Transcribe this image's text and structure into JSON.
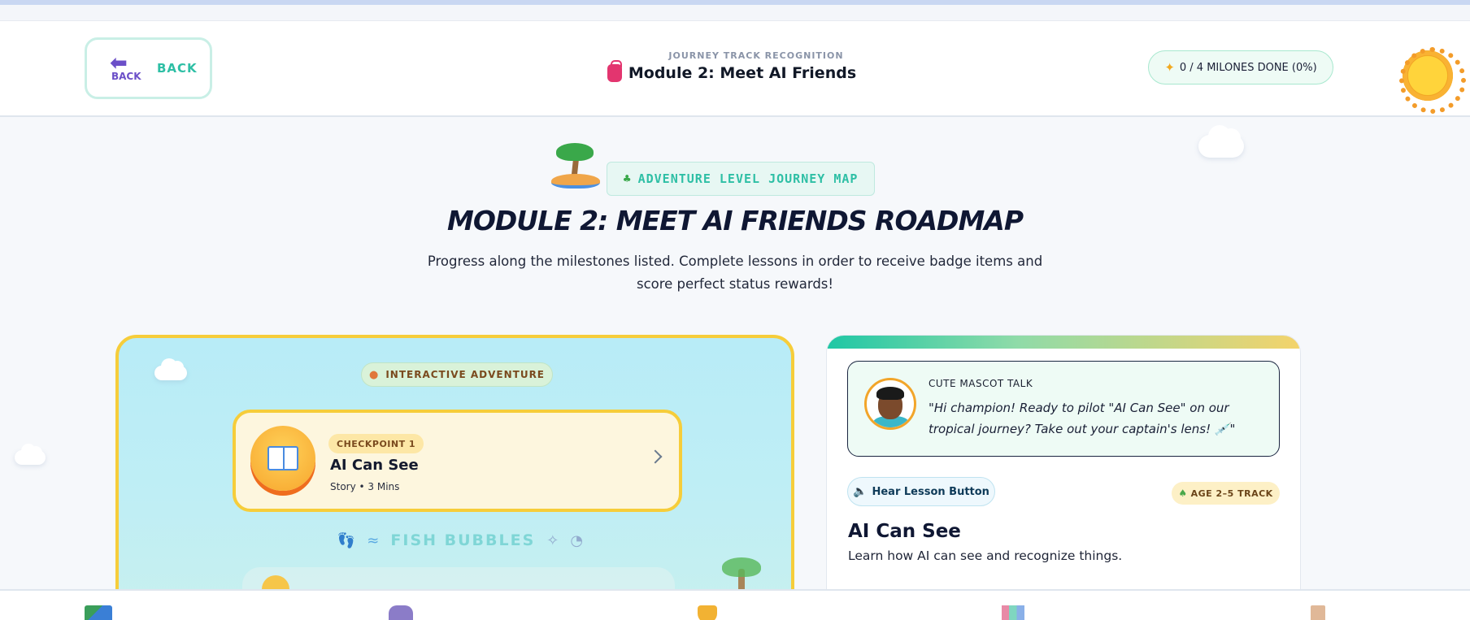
{
  "header": {
    "back": {
      "icon_label": "BACK",
      "label": "BACK"
    },
    "subtitle": "JOURNEY TRACK RECOGNITION",
    "title": "Module 2: Meet AI Friends",
    "progress": "0 / 4 MILONES DONE (0%)"
  },
  "hero": {
    "badge": "ADVENTURE LEVEL JOURNEY MAP",
    "title": "MODULE 2: MEET AI FRIENDS ROADMAP",
    "description": "Progress along the milestones listed. Complete lessons in order to receive badge items and score perfect status rewards!"
  },
  "adventure": {
    "pill": "INTERACTIVE ADVENTURE",
    "checkpoint": {
      "tag": "CHECKPOINT 1",
      "title": "AI Can See",
      "meta": "Story • 3 Mins"
    },
    "divider_label": "FISH BUBBLES"
  },
  "lesson": {
    "mascot_label": "CUTE MASCOT TALK",
    "mascot_quote": "\"Hi champion! Ready to pilot \"AI Can See\" on our tropical journey? Take out your captain's lens! 💉\"",
    "hear_button": "Hear Lesson Button",
    "age_pill": "AGE 2–5 TRACK",
    "title": "AI Can See",
    "description": "Learn how AI can see and recognize things."
  },
  "colors": {
    "accent_teal": "#2ebfa5",
    "accent_yellow": "#f6cd3a",
    "brand_purple": "#6b4fc8"
  },
  "icons": [
    "back-arrow-icon",
    "backpack-icon",
    "sparkle-icon",
    "sun-icon",
    "island-icon",
    "palm-tree-icon",
    "person-icon",
    "book-icon",
    "chevron-right-icon",
    "footprints-icon",
    "wave-icon",
    "shell-icon",
    "speaker-icon",
    "sprout-icon",
    "map-icon",
    "gamepad-icon",
    "trophy-icon",
    "chart-icon",
    "door-icon"
  ]
}
